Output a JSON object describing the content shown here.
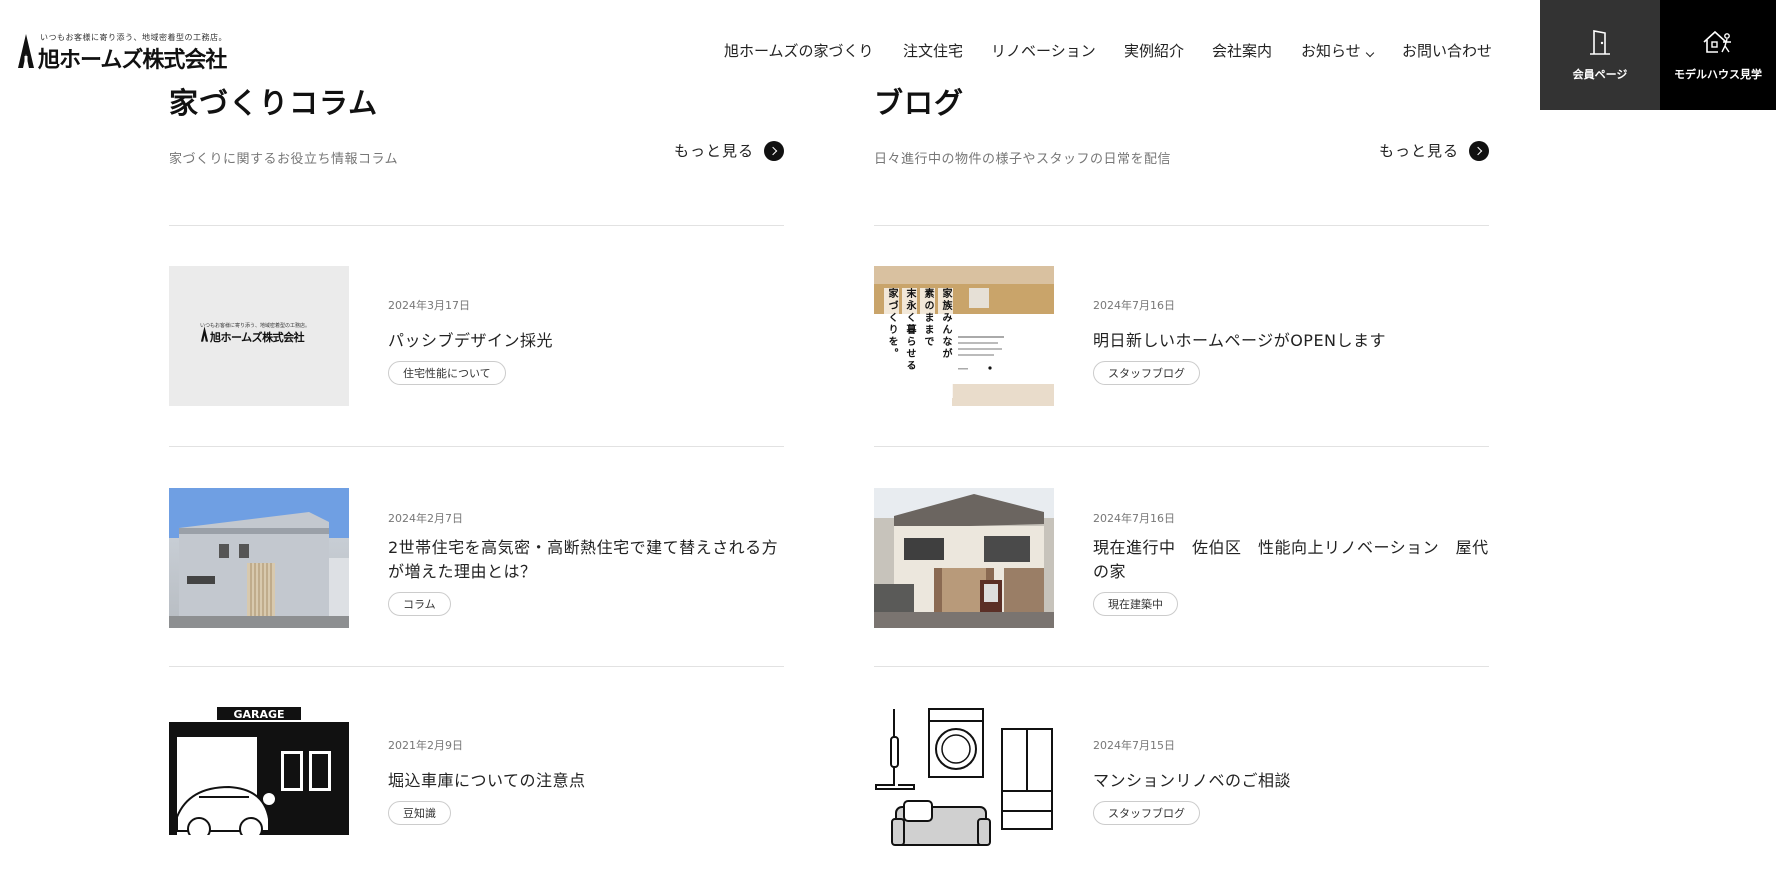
{
  "header": {
    "logo_tagline": "いつもお客様に寄り添う、地域密着型の工務店。",
    "logo_name": "旭ホームズ株式会社",
    "nav": [
      {
        "label": "旭ホームズの家づくり"
      },
      {
        "label": "注文住宅"
      },
      {
        "label": "リノベーション"
      },
      {
        "label": "実例紹介"
      },
      {
        "label": "会社案内"
      },
      {
        "label": "お知らせ"
      },
      {
        "label": "お問い合わせ"
      }
    ],
    "member_label": "会員ページ",
    "model_label": "モデルハウス見学"
  },
  "column_left": {
    "title": "家づくりコラム",
    "subtitle": "家づくりに関するお役立ち情報コラム",
    "more": "もっと見る",
    "entries": [
      {
        "date": "2024年3月17日",
        "title": "パッシブデザイン採光",
        "tag": "住宅性能について",
        "thumb_logo_tagline": "いつもお客様に寄り添う、地域密着型の工務店。",
        "thumb_logo_name": "旭ホームズ株式会社"
      },
      {
        "date": "2024年2月7日",
        "title": "2世帯住宅を高気密・高断熱住宅で建て替えされる方が増えた理由とは？",
        "tag": "コラム"
      },
      {
        "date": "2021年2月9日",
        "title": "堀込車庫についての注意点",
        "tag": "豆知識",
        "thumb_sign": "GARAGE"
      }
    ]
  },
  "column_right": {
    "title": "ブログ",
    "subtitle": "日々進行中の物件の様子やスタッフの日常を配信",
    "more": "もっと見る",
    "entries": [
      {
        "date": "2024年7月16日",
        "title": "明日新しいホームページがOPENします",
        "tag": "スタッフブログ",
        "thumb_text": [
          "家族みんなが",
          "素のままで",
          "末永く暮らせる",
          "家づくりを。"
        ]
      },
      {
        "date": "2024年7月16日",
        "title": "現在進行中　佐伯区　性能向上リノベーション　屋代の家",
        "tag": "現在建築中"
      },
      {
        "date": "2024年7月15日",
        "title": "マンションリノベのご相談",
        "tag": "スタッフブログ"
      }
    ]
  }
}
